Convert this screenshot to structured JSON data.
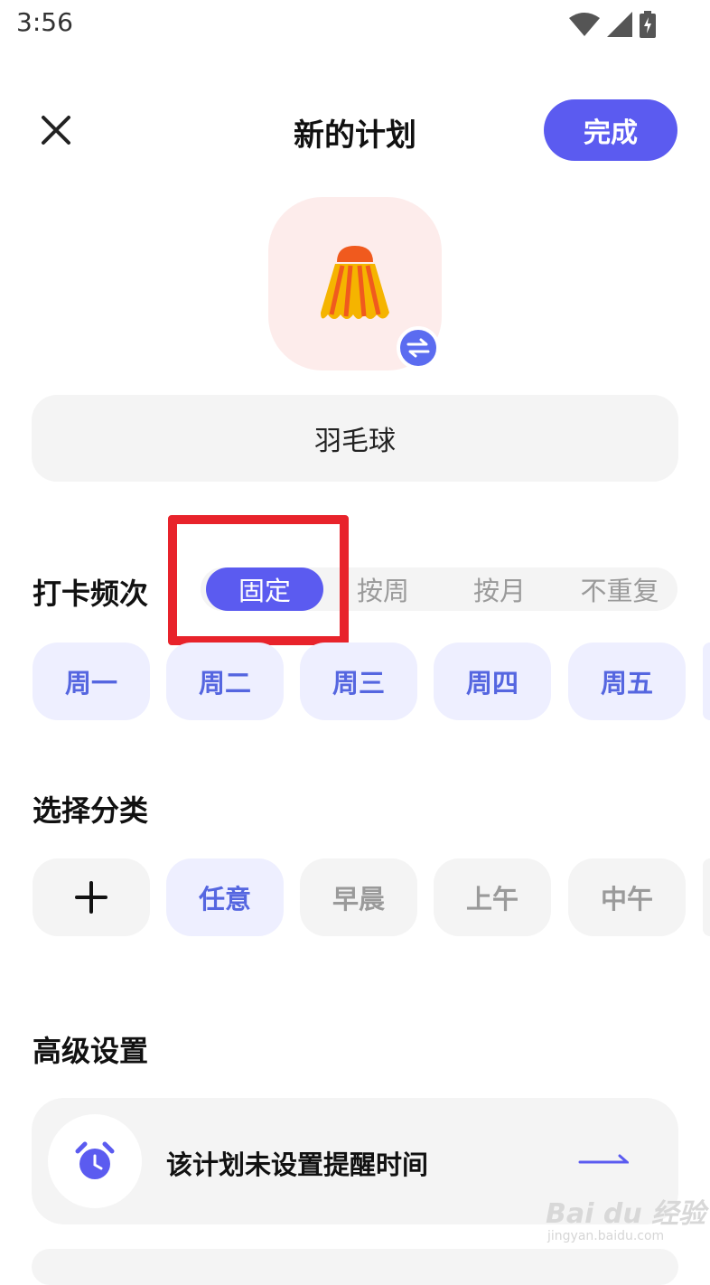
{
  "status_bar": {
    "time": "3:56",
    "icons": [
      "wifi-icon",
      "signal-icon",
      "battery-charging-icon"
    ]
  },
  "header": {
    "title": "新的计划",
    "done_label": "完成",
    "close_icon": "close-icon"
  },
  "plan": {
    "icon": "badminton-shuttlecock-icon",
    "swap_icon": "swap-icon",
    "name": "羽毛球"
  },
  "frequency": {
    "label": "打卡频次",
    "options": [
      "固定",
      "按周",
      "按月",
      "不重复"
    ],
    "selected": "固定",
    "days": [
      "周一",
      "周二",
      "周三",
      "周四",
      "周五"
    ]
  },
  "category": {
    "label": "选择分类",
    "add_icon": "plus-icon",
    "options": [
      "任意",
      "早晨",
      "上午",
      "中午"
    ],
    "selected": "任意"
  },
  "advanced": {
    "label": "高级设置",
    "reminder_text": "该计划未设置提醒时间",
    "alarm_icon": "alarm-clock-icon",
    "arrow_icon": "arrow-right-icon"
  },
  "watermark": {
    "text": "Bai du 经验",
    "sub": "jingyan.baidu.com"
  },
  "colors": {
    "accent": "#5b5bf0",
    "chip_bg": "#eeefff",
    "chip_text": "#5566e0",
    "highlight": "#e8232b"
  }
}
